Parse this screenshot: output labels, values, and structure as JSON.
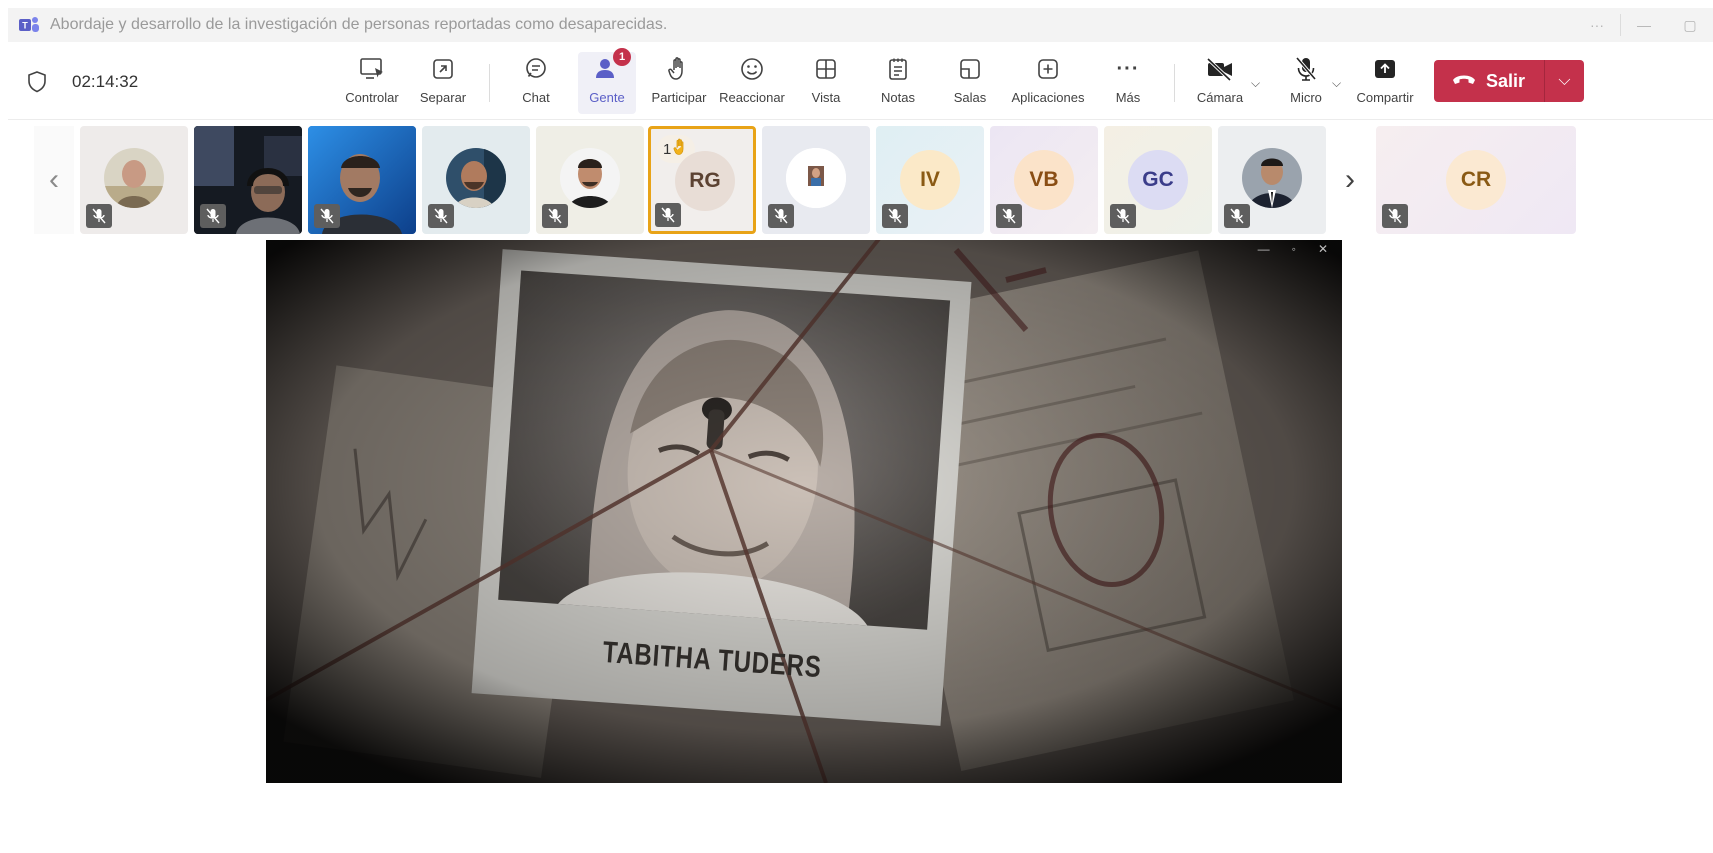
{
  "window": {
    "title": "Abordaje y desarrollo de la investigación de personas reportadas como desaparecidas.",
    "more": "···",
    "minimize": "—",
    "maximize": "▢"
  },
  "toolbar": {
    "timer": "02:14:32",
    "buttons": {
      "controlar": "Controlar",
      "separar": "Separar",
      "chat": "Chat",
      "gente": "Gente",
      "participar": "Participar",
      "reaccionar": "Reaccionar",
      "vista": "Vista",
      "notas": "Notas",
      "salas": "Salas",
      "aplicaciones": "Aplicaciones",
      "mas": "Más",
      "camara": "Cámara",
      "micro": "Micro",
      "compartir": "Compartir"
    },
    "people_badge": "1",
    "leave_label": "Salir",
    "more_glyph": "···"
  },
  "participants": {
    "prev_arrow": "‹",
    "next_arrow": "›",
    "tiles": [
      {
        "id": "p1",
        "kind": "photo"
      },
      {
        "id": "p2",
        "kind": "video"
      },
      {
        "id": "p3",
        "kind": "video"
      },
      {
        "id": "p4",
        "kind": "photo"
      },
      {
        "id": "p5",
        "kind": "photo"
      },
      {
        "id": "p6",
        "kind": "initials",
        "initials": "RG",
        "hand_count": "1"
      },
      {
        "id": "p7",
        "kind": "photo"
      },
      {
        "id": "p8",
        "kind": "initials",
        "initials": "IV"
      },
      {
        "id": "p9",
        "kind": "initials",
        "initials": "VB"
      },
      {
        "id": "p10",
        "kind": "initials",
        "initials": "GC"
      },
      {
        "id": "p11",
        "kind": "photo"
      },
      {
        "id": "p12",
        "kind": "initials",
        "initials": "CR"
      }
    ]
  },
  "shared_video": {
    "caption": "TABITHA TUDERS"
  },
  "colors": {
    "accent": "#5b5fc7",
    "leave": "#c4314b",
    "raise_hand_border": "#e8a317"
  }
}
